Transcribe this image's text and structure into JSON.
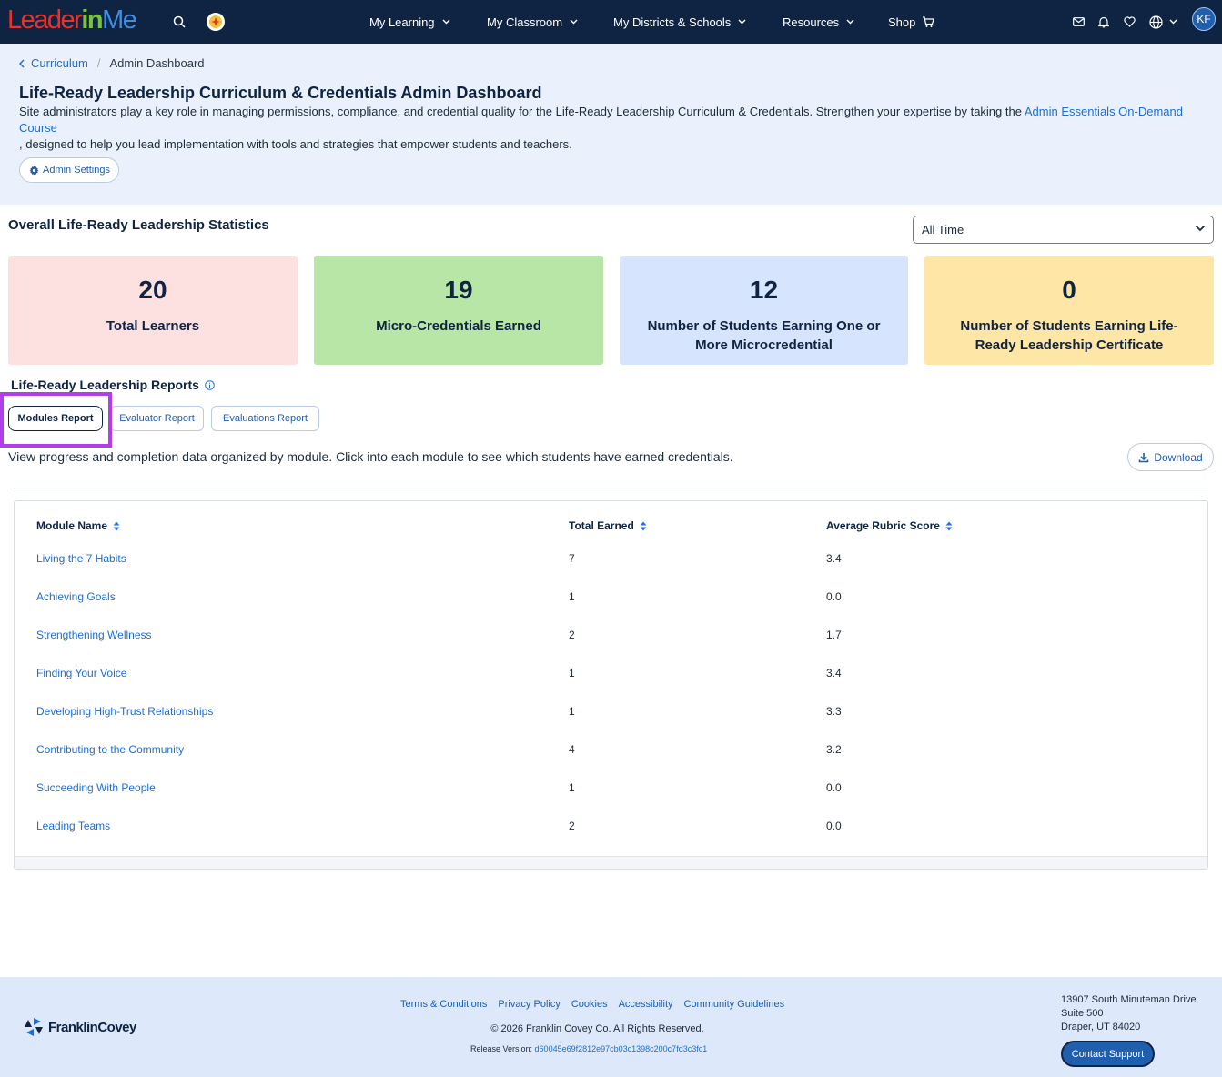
{
  "topnav": {
    "logo": {
      "part1": "Leader",
      "part2": "in",
      "part3": "Me"
    },
    "menus": [
      {
        "label": "My Learning"
      },
      {
        "label": "My Classroom"
      },
      {
        "label": "My Districts & Schools"
      },
      {
        "label": "Resources"
      },
      {
        "label": "Shop"
      }
    ],
    "avatar_initials": "KF"
  },
  "breadcrumb": {
    "parent": "Curriculum",
    "current": "Admin Dashboard"
  },
  "header": {
    "title": "Life-Ready Leadership Curriculum & Credentials Admin Dashboard",
    "description_before": "Site administrators play a key role in managing permissions, compliance, and credential quality for the Life-Ready Leadership Curriculum & Credentials. Strengthen your expertise by taking the ",
    "description_link": "Admin Essentials On-Demand Course",
    "description_after": ", designed to help you lead implementation with tools and strategies that empower students and teachers.",
    "admin_settings_label": "Admin Settings"
  },
  "stats": {
    "title": "Overall Life-Ready Leadership Statistics",
    "time_filter": "All Time",
    "cards": [
      {
        "value": "20",
        "label": "Total Learners",
        "color": "#fde0e0"
      },
      {
        "value": "19",
        "label": "Micro-Credentials Earned",
        "color": "#b8e6a6"
      },
      {
        "value": "12",
        "label": "Number of Students Earning One or More Microcredential",
        "color": "#d6e4fd"
      },
      {
        "value": "0",
        "label": "Number of Students Earning Life-Ready Leadership Certificate",
        "color": "#fde6a6"
      }
    ]
  },
  "reports": {
    "title": "Life-Ready Leadership Reports",
    "tabs": [
      {
        "label": "Modules Report",
        "active": true
      },
      {
        "label": "Evaluator Report",
        "active": false
      },
      {
        "label": "Evaluations Report",
        "active": false
      }
    ],
    "description": "View progress and completion data organized by module. Click into each module to see which students have earned credentials.",
    "download_label": "Download"
  },
  "table": {
    "columns": [
      "Module Name",
      "Total Earned",
      "Average Rubric Score"
    ],
    "rows": [
      {
        "name": "Living the 7 Habits",
        "earned": "7",
        "score": "3.4"
      },
      {
        "name": "Achieving Goals",
        "earned": "1",
        "score": "0.0"
      },
      {
        "name": "Strengthening Wellness",
        "earned": "2",
        "score": "1.7"
      },
      {
        "name": "Finding Your Voice",
        "earned": "1",
        "score": "3.4"
      },
      {
        "name": "Developing High-Trust Relationships",
        "earned": "1",
        "score": "3.3"
      },
      {
        "name": "Contributing to the Community",
        "earned": "4",
        "score": "3.2"
      },
      {
        "name": "Succeeding With People",
        "earned": "1",
        "score": "0.0"
      },
      {
        "name": "Leading Teams",
        "earned": "2",
        "score": "0.0"
      }
    ]
  },
  "footer": {
    "brand": "FranklinCovey",
    "links": [
      "Terms & Conditions",
      "Privacy Policy",
      "Cookies",
      "Accessibility",
      "Community Guidelines"
    ],
    "copyright": "© 2026 Franklin Covey Co. All Rights Reserved.",
    "release_label": "Release Version: ",
    "release_hash": "d60045e69f2812e97cb03c1398c200c7fd3c3fc1",
    "address": [
      "13907 South Minuteman Drive",
      "Suite 500",
      "Draper, UT 84020"
    ],
    "contact_label": "Contact Support"
  },
  "colors": {
    "nav_bg": "#0f2342",
    "accent": "#1f6fce",
    "highlight": "#b13ee8"
  }
}
